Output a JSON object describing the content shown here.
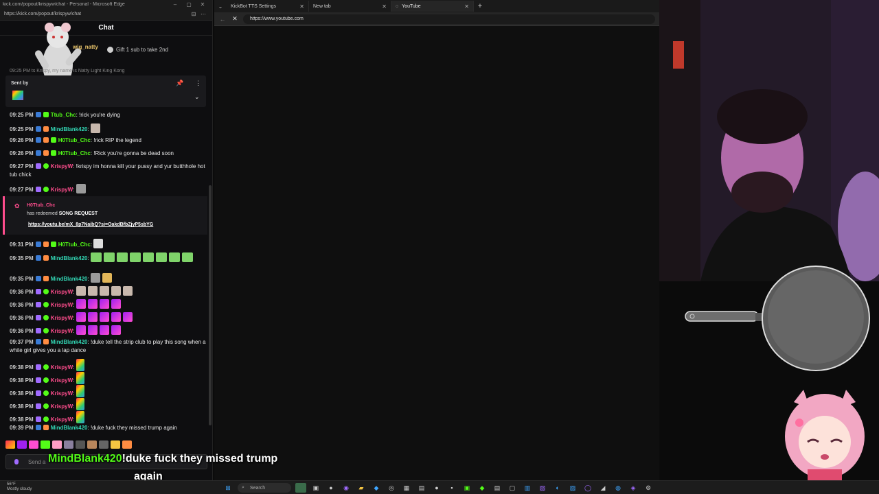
{
  "popout": {
    "title": "kick.com/popout/krispyw/chat - Personal - Microsoft Edge",
    "url": "https://kick.com/popout/krispyw/chat"
  },
  "chat": {
    "header": "Chat",
    "gifter_name": "wig_natty",
    "gift_button": "Gift 1 sub to take 2nd",
    "prev_message_time": "09:25 PM",
    "prev_message_text": "ts Krispy, my name is Natty Light King Kong",
    "pinned_sent_by": "Sent by",
    "messages": [
      {
        "time": "09:25 PM",
        "user": "Ttub_Chc",
        "color": "green",
        "text": "!rick you're dying"
      },
      {
        "time": "09:25 PM",
        "user": "MindBlank420",
        "color": "teal",
        "text": "",
        "emote": "face"
      },
      {
        "time": "09:26 PM",
        "user": "H0Ttub_Chc",
        "color": "green",
        "text": "!rick RIP the legend"
      },
      {
        "time": "09:26 PM",
        "user": "H0Ttub_Chc",
        "color": "green",
        "text": "!Rick you're gonna be dead soon"
      },
      {
        "time": "09:27 PM",
        "user": "KrispyW",
        "color": "pink",
        "text": "!krispy im honna kill your pussy and yur butthhole hot tub chick"
      },
      {
        "time": "09:27 PM",
        "user": "KrispyW",
        "color": "pink",
        "text": "",
        "emote": "cat"
      }
    ],
    "redeem": {
      "user": "H0Ttub_Chc",
      "prefix": "has redeemed",
      "reward": "SONG REQUEST",
      "link": "https://youtu.be/mX_8p7NaibQ?si=OakdBfbZjyP5sbYG"
    },
    "messages2": [
      {
        "time": "09:31 PM",
        "user": "H0Ttub_Chc",
        "color": "green",
        "text": ""
      },
      {
        "time": "09:35 PM",
        "user": "MindBlank420",
        "color": "teal",
        "text": ""
      },
      {
        "time": "09:35 PM",
        "user": "MindBlank420",
        "color": "teal",
        "text": ""
      },
      {
        "time": "09:36 PM",
        "user": "KrispyW",
        "color": "pink",
        "text": ""
      },
      {
        "time": "09:36 PM",
        "user": "KrispyW",
        "color": "pink",
        "text": ""
      },
      {
        "time": "09:36 PM",
        "user": "KrispyW",
        "color": "pink",
        "text": ""
      },
      {
        "time": "09:36 PM",
        "user": "KrispyW",
        "color": "pink",
        "text": ""
      },
      {
        "time": "09:37 PM",
        "user": "MindBlank420",
        "color": "teal",
        "text": "!duke tell the strip club to play this song when a white girl gives you a lap dance"
      },
      {
        "time": "09:38 PM",
        "user": "KrispyW",
        "color": "pink",
        "text": ""
      },
      {
        "time": "09:38 PM",
        "user": "KrispyW",
        "color": "pink",
        "text": ""
      },
      {
        "time": "09:38 PM",
        "user": "KrispyW",
        "color": "pink",
        "text": ""
      },
      {
        "time": "09:38 PM",
        "user": "KrispyW",
        "color": "pink",
        "text": ""
      },
      {
        "time": "09:38 PM",
        "user": "KrispyW",
        "color": "pink",
        "text": ""
      },
      {
        "time": "09:39 PM",
        "user": "MindBlank420",
        "color": "teal",
        "text": "!duke fuck they missed trump again"
      }
    ],
    "send_placeholder": "Send a"
  },
  "browser": {
    "tabs": [
      {
        "label": "KickBot TTS Settings"
      },
      {
        "label": "New tab"
      },
      {
        "label": "YouTube"
      }
    ],
    "url": "https://www.youtube.com"
  },
  "overlay": {
    "subtitle_user": "MindBlank420",
    "subtitle_text": "!duke fuck they missed trump",
    "subtitle_line2": "again"
  },
  "taskbar": {
    "weather_temp": "56°F",
    "weather_desc": "Mostly cloudy",
    "search_label": "Search"
  },
  "colors": {
    "kick_green": "#53fc18",
    "teal_user": "#32d6b4",
    "pink_user": "#ff4d8d"
  }
}
